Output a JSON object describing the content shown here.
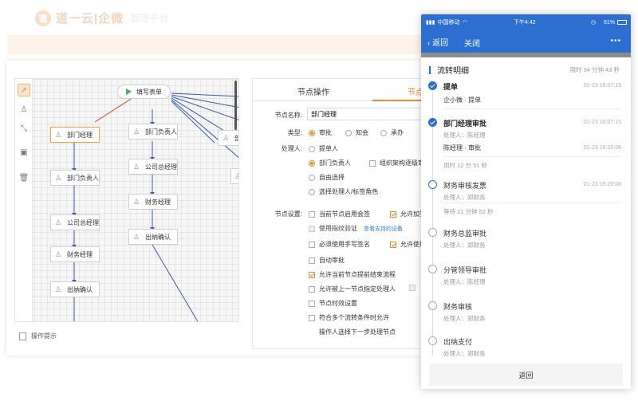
{
  "brand": {
    "logo_char": "道",
    "name": "道一云|企微",
    "subtitle": "管理平台"
  },
  "toolbar_icons": [
    "pointer-icon",
    "user-icon",
    "connector-icon",
    "image-icon",
    "trash-icon"
  ],
  "flow": {
    "start": "填写表单",
    "col1": [
      "部门经理",
      "部门负责人",
      "公司总经理",
      "财务经理",
      "出纳确认"
    ],
    "col2": [
      "部门负责人",
      "公司总经理",
      "财务经理",
      "出纳确认"
    ],
    "col3_partial": "部"
  },
  "op_hint": "操作提示",
  "props": {
    "tabs": [
      "节点操作",
      "节点"
    ],
    "name_label": "节点名称:",
    "name_value": "部门经理",
    "type_label": "类型:",
    "type_options": [
      "审批",
      "知会",
      "承办"
    ],
    "handler_label": "处理人:",
    "handler_options": [
      "提单人",
      "部门负责人",
      "组织架构逐级审",
      "自由选择",
      "选择处理人/标签角色"
    ],
    "settings_label": "节点设置:",
    "settings": {
      "row1a": "当前节点启用会签",
      "row1b": "允许加签",
      "row2": "使用指纹验证",
      "row2_link": "查看支持的设备",
      "row3a": "必须使用手写签名",
      "row3b": "允许使用",
      "row4": "自动审批",
      "row5": "允许当前节点提前结束流程",
      "row6": "允许被上一节点指定处理人",
      "row7": "节点时效设置",
      "row8": "符合多个流转条件时允许",
      "row9": "操作人选择下一步处理节点"
    }
  },
  "phone": {
    "status": {
      "carrier": "中国移动",
      "time": "下午4:42",
      "battery": "61%"
    },
    "nav": {
      "back": "返回",
      "close": "关闭",
      "more": "•••"
    },
    "detail_title": "流转明细",
    "total_time": "用时 34 分钟 43 秒",
    "steps": [
      {
        "title": "提单",
        "time": "01-23 16:07:15",
        "sub": "企小微 · 提单"
      },
      {
        "title": "部门经理审批",
        "time": "01-23 16:07:15",
        "sub": "处理人：陈经理",
        "sub2": "陈经理 · 审批",
        "time2": "01-23 16:20:06",
        "grey": "用时 12 分 51 秒"
      },
      {
        "title": "财务审核发票",
        "time": "01-23 16:20:06",
        "sub": "处理人：郑财务",
        "grey": "等待 21 分钟 52 秒"
      },
      {
        "title": "财务总监审批",
        "sub": "处理人：郑财务"
      },
      {
        "title": "分管领导审批",
        "sub": "处理人：陈经理"
      },
      {
        "title": "财务审核",
        "sub": "处理人：郑财务"
      },
      {
        "title": "出纳支付",
        "sub": "处理人：郑财务"
      }
    ],
    "back_button": "返回"
  }
}
